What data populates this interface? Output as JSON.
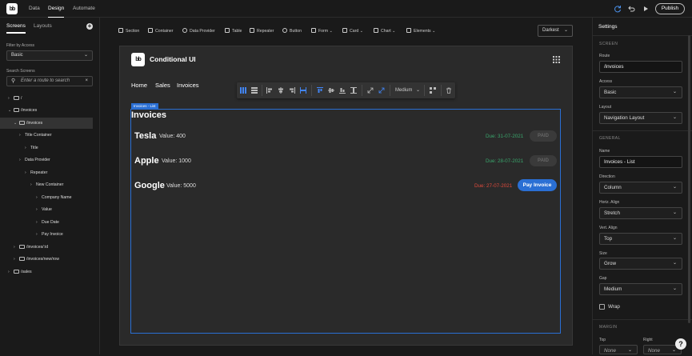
{
  "topbar": {
    "logo": "bb",
    "nav": [
      "Data",
      "Design",
      "Automate"
    ],
    "active_nav": "Design",
    "publish_label": "Publish",
    "icons": [
      "refresh-icon",
      "undo-icon",
      "play-icon"
    ]
  },
  "leftpanel": {
    "tabs": [
      "Screens",
      "Layouts"
    ],
    "filter_label": "Filter by Access",
    "filter_value": "Basic",
    "search_label": "Search Screens",
    "search_placeholder": "Enter a route to search",
    "tree": [
      {
        "label": "/"
      },
      {
        "label": "/invoices"
      },
      {
        "label": "/invoices"
      },
      {
        "label": "Title Container"
      },
      {
        "label": "Title"
      },
      {
        "label": "Data Provider"
      },
      {
        "label": "Repeater"
      },
      {
        "label": "New Container"
      },
      {
        "label": "Company Name"
      },
      {
        "label": "Value"
      },
      {
        "label": "Due Date"
      },
      {
        "label": "Pay Invoice"
      },
      {
        "label": "/invoices/:id"
      },
      {
        "label": "/invoices/new/row"
      },
      {
        "label": "/sales"
      }
    ]
  },
  "toolbar": {
    "items": [
      "Section",
      "Container",
      "Data Provider",
      "Table",
      "Repeater",
      "Button",
      "Form",
      "Card",
      "Chart",
      "Elements"
    ],
    "theme": "Darkest"
  },
  "app": {
    "logo": "bb",
    "title": "Conditional UI",
    "nav": [
      "Home",
      "Sales",
      "Invoices"
    ],
    "format_size": "Medium",
    "selected_label": "Invoices - List",
    "heading": "Invoices",
    "rows": [
      {
        "company": "Tesla",
        "value": "Value: 400",
        "due": "Due: 31-07-2021",
        "action": "PAID",
        "status": "paid"
      },
      {
        "company": "Apple",
        "value": "Value: 1000",
        "due": "Due: 28-07-2021",
        "action": "PAID",
        "status": "paid"
      },
      {
        "company": "Google",
        "value": "Value: 5000",
        "due": "Due: 27-07-2021",
        "action": "Pay Invoice",
        "status": "overdue"
      }
    ]
  },
  "settings": {
    "title": "Settings",
    "screen_h": "SCREEN",
    "route_label": "Route",
    "route_value": "/invoices",
    "access_label": "Access",
    "access_value": "Basic",
    "layout_label": "Layout",
    "layout_value": "Navigation Layout",
    "general_h": "GENERAL",
    "name_label": "Name",
    "name_value": "Invoices - List",
    "direction_label": "Direction",
    "direction_value": "Column",
    "halign_label": "Horiz. Align",
    "halign_value": "Stretch",
    "valign_label": "Vert. Align",
    "valign_value": "Top",
    "size_label": "Size",
    "size_value": "Grow",
    "gap_label": "Gap",
    "gap_value": "Medium",
    "wrap_label": "Wrap",
    "margin_h": "MARGIN",
    "top_label": "Top",
    "top_value": "None",
    "right_label": "Right",
    "right_value": "None"
  },
  "colors": {
    "accent": "#2a6fd4",
    "paid_green": "#3aa66c",
    "overdue_red": "#e04a3c"
  }
}
